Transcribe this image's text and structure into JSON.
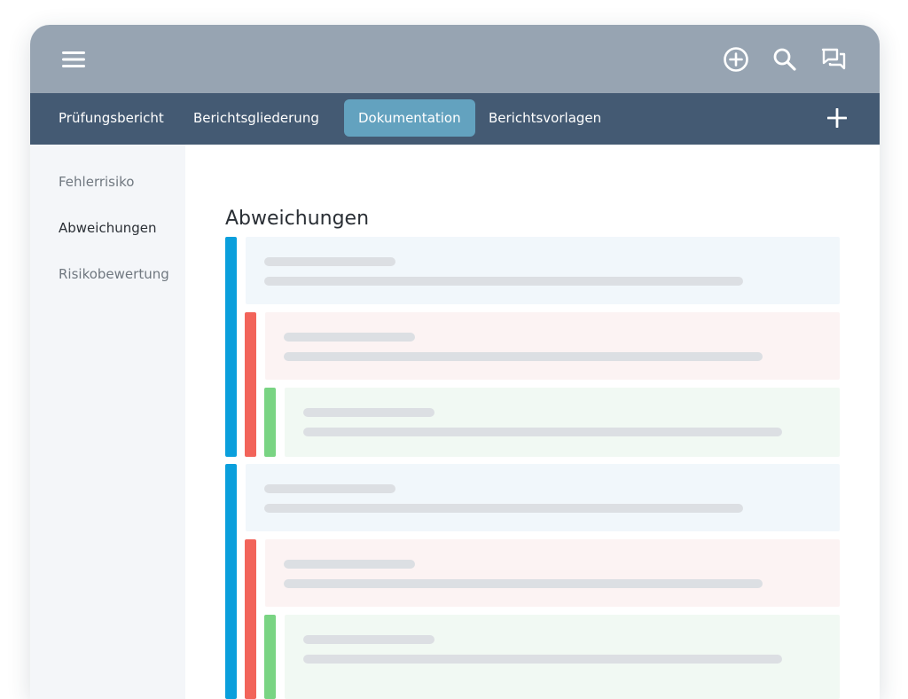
{
  "topbar": {
    "icons": [
      "menu-icon",
      "add-circle-icon",
      "search-icon",
      "chat-icon"
    ]
  },
  "tabs": [
    {
      "label": "Prüfungsbericht",
      "active": false
    },
    {
      "label": "Berichtsgliederung",
      "active": false
    },
    {
      "label": "Dokumentation",
      "active": true
    },
    {
      "label": "Berichtsvorlagen",
      "active": false
    }
  ],
  "add_tab_icon": "plus-icon",
  "sidebar": {
    "items": [
      {
        "label": "Fehlerrisiko",
        "active": false
      },
      {
        "label": "Abweichungen",
        "active": true
      },
      {
        "label": "Risikobewertung",
        "active": false
      }
    ]
  },
  "main": {
    "title": "Abweichungen"
  },
  "colors": {
    "topbar": "#97a4b2",
    "tabbar": "#445a73",
    "active_tab": "#63a2bf",
    "level_1": "#0a9fdc",
    "level_2": "#f2645a",
    "level_3": "#79d483"
  }
}
